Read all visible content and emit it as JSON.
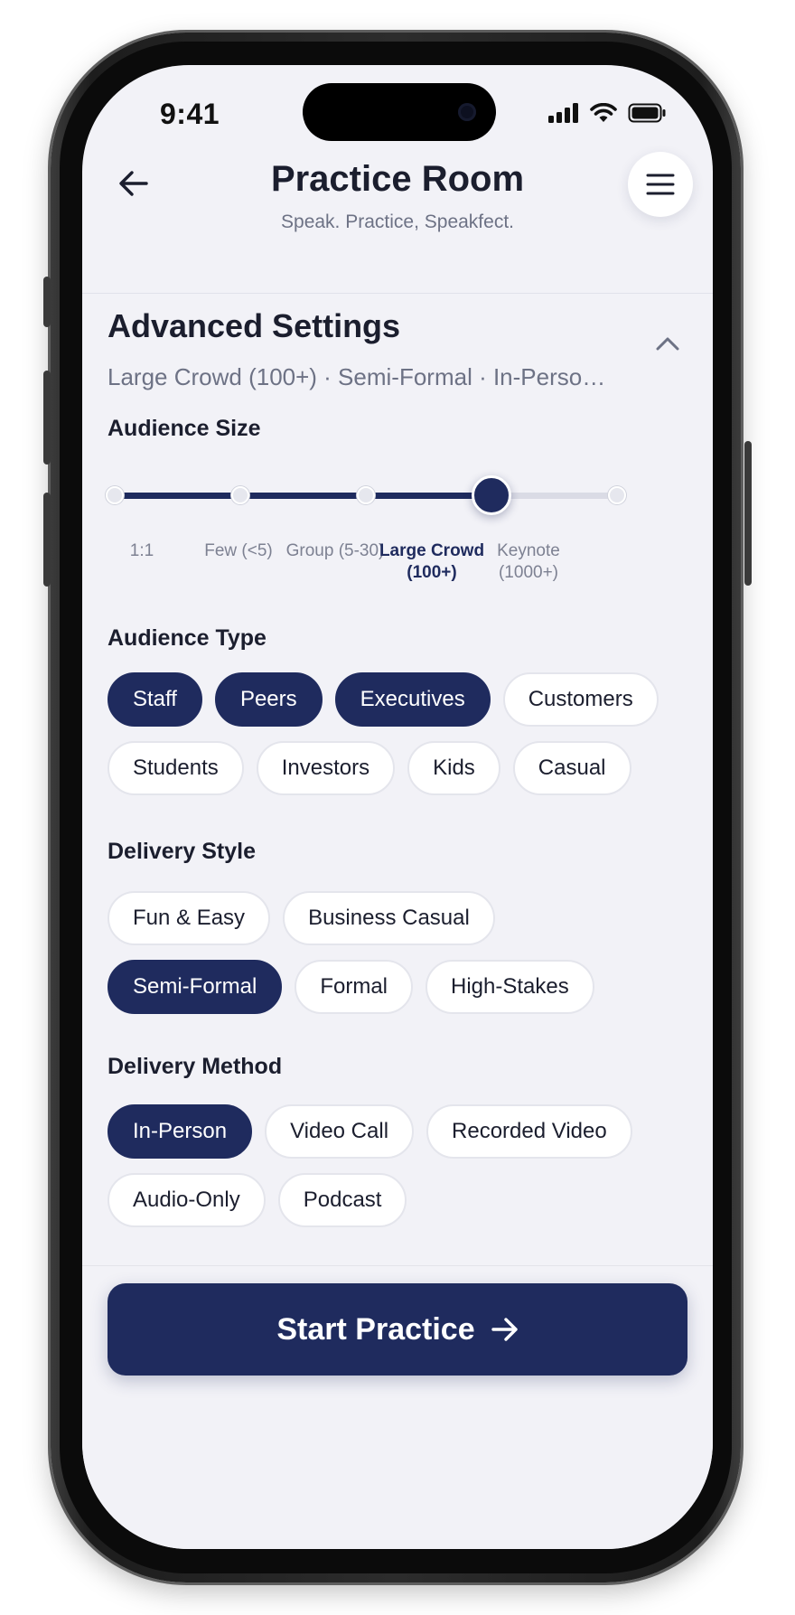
{
  "status_bar": {
    "time": "9:41",
    "icons": [
      "cellular-signal-icon",
      "wifi-icon",
      "battery-icon"
    ]
  },
  "header": {
    "back_icon": "arrow-left-icon",
    "title": "Practice Room",
    "subtitle": "Speak. Practice, Speakfect.",
    "menu_icon": "hamburger-menu-icon"
  },
  "advanced_settings": {
    "title": "Advanced Settings",
    "summary": "Large Crowd (100+) · Semi-Formal · In-Person ...",
    "toggle_icon": "chevron-up-icon"
  },
  "audience_size": {
    "label": "Audience Size",
    "options": [
      "1:1",
      "Few (<5)",
      "Group (5-30)",
      "Large Crowd (100+)",
      "Keynote (1000+)"
    ],
    "selected_index": 3
  },
  "audience_type": {
    "label": "Audience Type",
    "rows": [
      [
        {
          "label": "Staff",
          "selected": true
        },
        {
          "label": "Peers",
          "selected": true
        },
        {
          "label": "Executives",
          "selected": true
        },
        {
          "label": "Customers",
          "selected": false
        }
      ],
      [
        {
          "label": "Students",
          "selected": false
        },
        {
          "label": "Investors",
          "selected": false
        },
        {
          "label": "Kids",
          "selected": false
        },
        {
          "label": "Casual",
          "selected": false
        }
      ]
    ]
  },
  "delivery_style": {
    "label": "Delivery Style",
    "rows": [
      [
        {
          "label": "Fun & Easy",
          "selected": false
        },
        {
          "label": "Business Casual",
          "selected": false
        }
      ],
      [
        {
          "label": "Semi-Formal",
          "selected": true
        },
        {
          "label": "Formal",
          "selected": false
        },
        {
          "label": "High-Stakes",
          "selected": false
        }
      ]
    ]
  },
  "delivery_method": {
    "label": "Delivery Method",
    "rows": [
      [
        {
          "label": "In-Person",
          "selected": true
        },
        {
          "label": "Video Call",
          "selected": false
        },
        {
          "label": "Recorded Video",
          "selected": false
        }
      ],
      [
        {
          "label": "Audio-Only",
          "selected": false
        },
        {
          "label": "Podcast",
          "selected": false
        }
      ]
    ]
  },
  "cta": {
    "label": "Start Practice",
    "icon": "arrow-right-icon"
  },
  "colors": {
    "accent": "#1f2b5e",
    "background": "#f2f2f7",
    "chip_background": "#ffffff",
    "text_primary": "#1b1e2e",
    "text_secondary": "#6d7285"
  }
}
